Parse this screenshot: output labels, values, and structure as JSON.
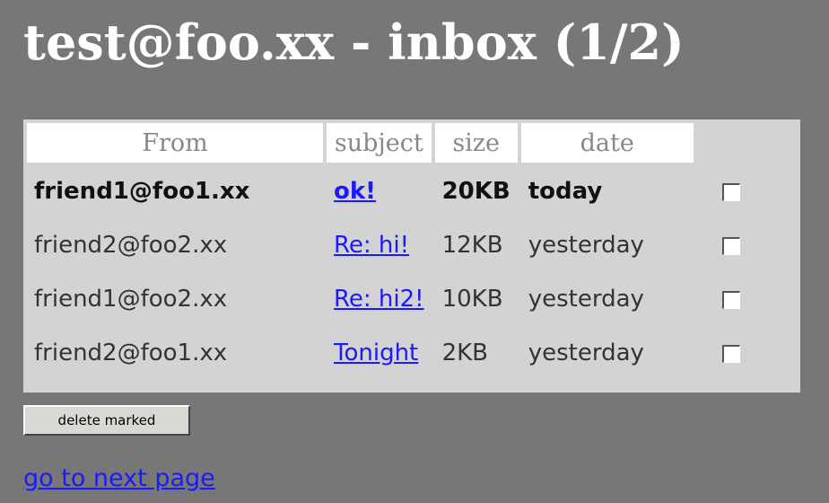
{
  "header": {
    "title": "test@foo.xx - inbox (1/2)"
  },
  "table": {
    "columns": [
      "From",
      "subject",
      "size",
      "date"
    ],
    "rows": [
      {
        "from": "friend1@foo1.xx",
        "subject": "ok!",
        "size": "20KB",
        "date": "today",
        "unread": true,
        "checked": false
      },
      {
        "from": "friend2@foo2.xx",
        "subject": "Re: hi!",
        "size": "12KB",
        "date": "yesterday",
        "unread": false,
        "checked": false
      },
      {
        "from": "friend1@foo2.xx",
        "subject": "Re: hi2!",
        "size": "10KB",
        "date": "yesterday",
        "unread": false,
        "checked": false
      },
      {
        "from": "friend2@foo1.xx",
        "subject": "Tonight",
        "size": "2KB",
        "date": "yesterday",
        "unread": false,
        "checked": false
      }
    ]
  },
  "actions": {
    "delete_label": "delete marked",
    "next_page_label": "go to next page"
  },
  "colors": {
    "background": "#777777",
    "panel": "#d3d3d3",
    "header_cell": "#ffffff",
    "link": "#1a1aff"
  }
}
